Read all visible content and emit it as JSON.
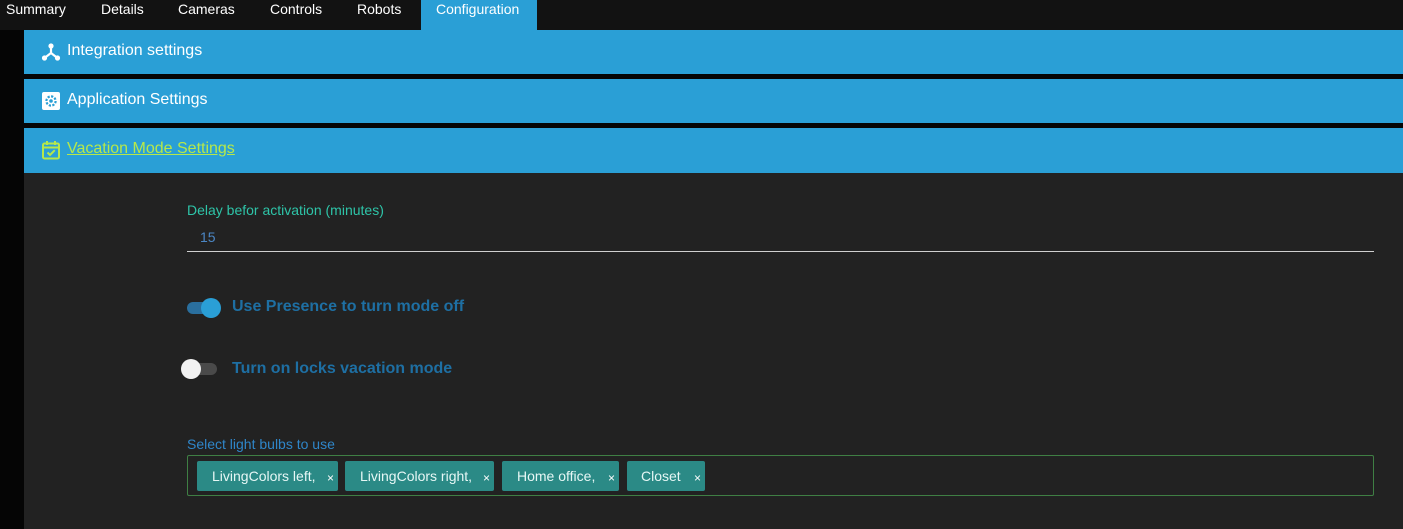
{
  "tabs": [
    {
      "label": "Summary",
      "active": false
    },
    {
      "label": "Details",
      "active": false
    },
    {
      "label": "Cameras",
      "active": false
    },
    {
      "label": "Controls",
      "active": false
    },
    {
      "label": "Robots",
      "active": false
    },
    {
      "label": "Configuration",
      "active": true
    }
  ],
  "sections": [
    {
      "label": "Integration settings",
      "icon": "hub-icon",
      "expanded": false
    },
    {
      "label": "Application Settings",
      "icon": "gear-icon",
      "expanded": false
    },
    {
      "label": "Vacation Mode Settings",
      "icon": "calendar-check-icon",
      "expanded": true
    }
  ],
  "vacation": {
    "delay_label": "Delay befor activation (minutes)",
    "delay_value": "15",
    "presence_toggle": {
      "label": "Use Presence to turn mode off",
      "on": true
    },
    "locks_toggle": {
      "label": "Turn on locks vacation mode",
      "on": false
    },
    "bulbs_label": "Select light bulbs to use",
    "bulbs": [
      "LivingColors left,",
      "LivingColors right,",
      "Home office,",
      "Closet"
    ],
    "chip_remove": "×"
  },
  "colors": {
    "accent": "#2a9fd6",
    "active_section_text": "#b6e84a",
    "chip_bg": "#2b8a86",
    "panel_bg": "#222222"
  }
}
